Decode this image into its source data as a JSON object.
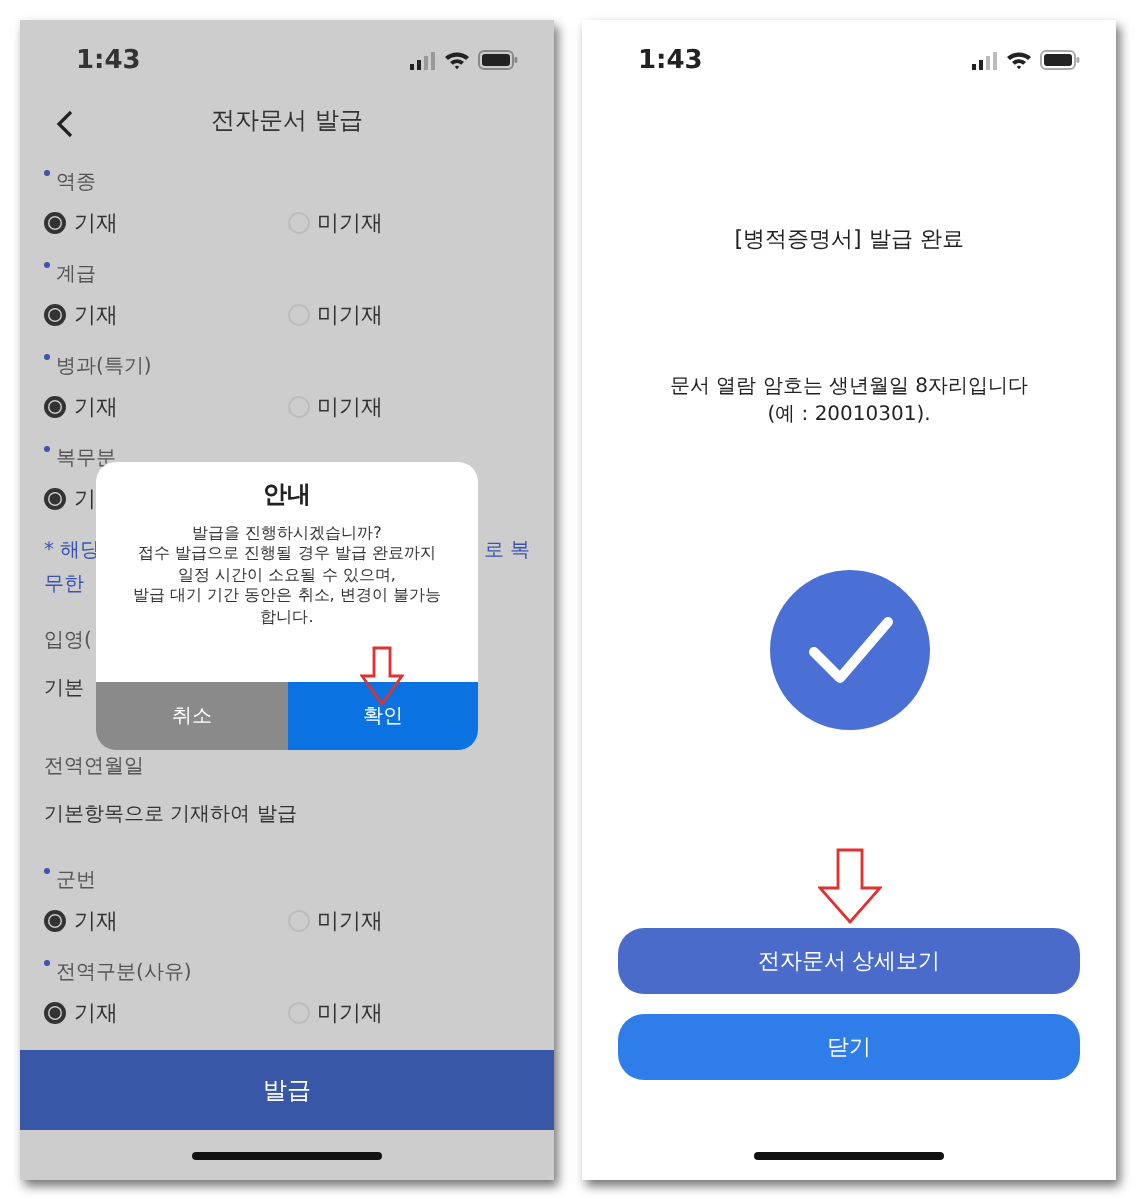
{
  "left_screen": {
    "status_bar": {
      "time": "1:43"
    },
    "header": {
      "title": "전자문서 발급"
    },
    "fields": [
      {
        "kind": "radio",
        "label": "역종",
        "required": true,
        "options": [
          {
            "label": "기재",
            "selected": true
          },
          {
            "label": "미기재",
            "selected": false
          }
        ]
      },
      {
        "kind": "radio",
        "label": "계급",
        "required": true,
        "options": [
          {
            "label": "기재",
            "selected": true
          },
          {
            "label": "미기재",
            "selected": false
          }
        ]
      },
      {
        "kind": "radio",
        "label": "병과(특기)",
        "required": true,
        "options": [
          {
            "label": "기재",
            "selected": true
          },
          {
            "label": "미기재",
            "selected": false
          }
        ]
      },
      {
        "kind": "radio",
        "label": "복무분",
        "required": true,
        "options": [
          {
            "label": "기",
            "selected": true
          }
        ]
      },
      {
        "kind": "note",
        "left": "* 해당",
        "right": "로 복",
        "second_line": "무한"
      },
      {
        "kind": "text",
        "label": "입영(",
        "value": "기본"
      },
      {
        "kind": "text",
        "label": "전역연월일",
        "value": "기본항목으로 기재하여 발급"
      },
      {
        "kind": "radio",
        "label": "군번",
        "required": true,
        "options": [
          {
            "label": "기재",
            "selected": true
          },
          {
            "label": "미기재",
            "selected": false
          }
        ]
      },
      {
        "kind": "radio",
        "label": "전역구분(사유)",
        "required": true,
        "options": [
          {
            "label": "기재",
            "selected": true
          },
          {
            "label": "미기재",
            "selected": false
          }
        ]
      }
    ],
    "submit_button": "발급",
    "dialog": {
      "title": "안내",
      "message": "발급을 진행하시겠습니까?\n접수 발급으로 진행될 경우 발급 완료까지\n일정 시간이 소요될 수 있으며,\n발급 대기 기간 동안은 취소, 변경이 불가능\n합니다.",
      "cancel": "취소",
      "confirm": "확인"
    }
  },
  "right_screen": {
    "status_bar": {
      "time": "1:43"
    },
    "title": "[병적증명서] 발급 완료",
    "message": "문서 열람 암호는 생년월일 8자리입니다\n(예 : 20010301).",
    "buttons": [
      {
        "label": "전자문서 상세보기",
        "kind": "primary"
      },
      {
        "label": "닫기",
        "kind": "secondary"
      }
    ]
  }
}
